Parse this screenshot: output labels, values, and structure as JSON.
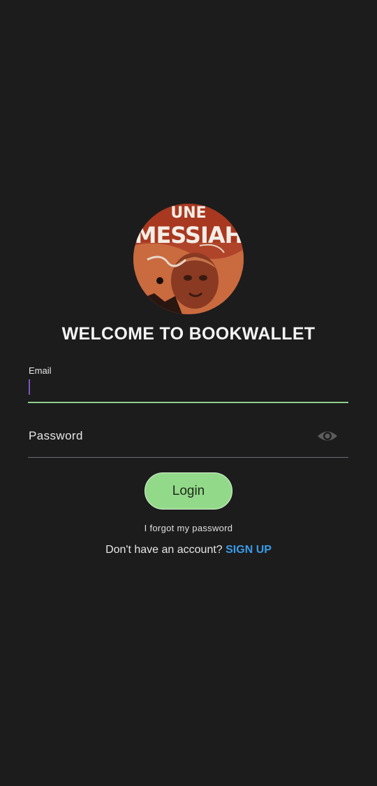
{
  "app": {
    "title": "WELCOME TO BOOKWALLET"
  },
  "avatar": {
    "icon": "book-cover-avatar",
    "cover_text": "UNE MESSIAH"
  },
  "email": {
    "label": "Email",
    "value": ""
  },
  "password": {
    "label": "Password",
    "value": "",
    "toggle_icon": "eye-icon"
  },
  "login": {
    "label": "Login"
  },
  "forgot": {
    "label": "I forgot my password"
  },
  "signup": {
    "prompt": "Don't have an account? ",
    "link": "SIGN UP"
  },
  "colors": {
    "background": "#1c1c1c",
    "accent_green": "#93d98a",
    "link_blue": "#3a9be8",
    "caret_purple": "#7e57c2"
  }
}
